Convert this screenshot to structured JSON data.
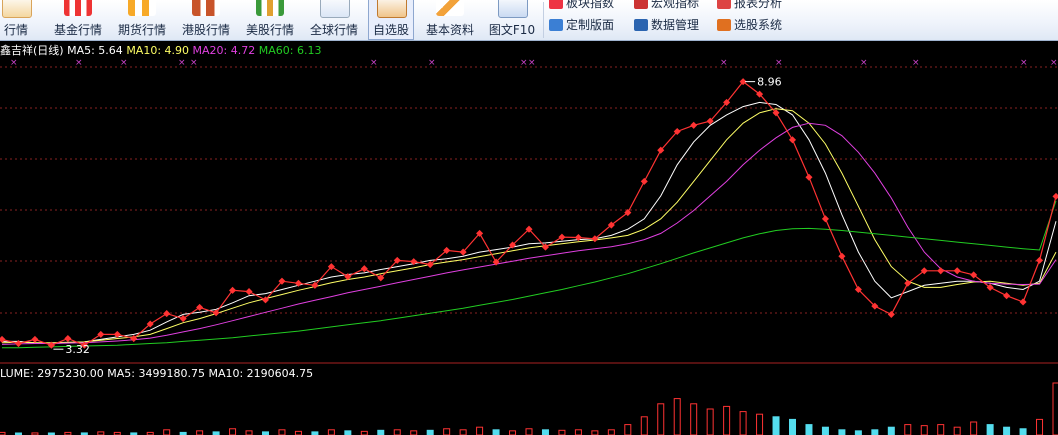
{
  "toolbar": {
    "items": [
      {
        "label": "行情",
        "icon": "chart-line-icon"
      },
      {
        "label": "基金行情",
        "icon": "bar-chart-icon"
      },
      {
        "label": "期货行情",
        "icon": "bar-chart-icon"
      },
      {
        "label": "港股行情",
        "icon": "bar-chart-icon"
      },
      {
        "label": "美股行情",
        "icon": "bar-chart-icon"
      },
      {
        "label": "全球行情",
        "icon": "line-chart-icon"
      },
      {
        "label": "自选股",
        "icon": "watchlist-icon"
      },
      {
        "label": "基本资料",
        "icon": "pencil-icon"
      },
      {
        "label": "图文F10",
        "icon": "document-icon"
      }
    ],
    "links": [
      {
        "label": "板块指数",
        "icon": "sector-index-icon"
      },
      {
        "label": "宏观指标",
        "icon": "macro-indicator-icon"
      },
      {
        "label": "报表分析",
        "icon": "report-icon"
      },
      {
        "label": "定制版面",
        "icon": "custom-layout-icon"
      },
      {
        "label": "数据管理",
        "icon": "data-manage-icon"
      },
      {
        "label": "选股系统",
        "icon": "stock-screener-icon"
      }
    ]
  },
  "legend": {
    "title": "鑫吉祥(日线)",
    "ma5": "MA5: 5.64",
    "ma10": "MA10: 4.90",
    "ma20": "MA20: 4.72",
    "ma60": "MA60: 6.13"
  },
  "volume_legend": {
    "text": "LUME: 2975230.00  MA5: 3499180.75  MA10: 2190604.75"
  },
  "annotations": {
    "high": "8.96",
    "low": "3.32"
  },
  "colors": {
    "price": "#ff3333",
    "ma5": "#ffffff",
    "ma10": "#ffff66",
    "ma20": "#e040e0",
    "ma60": "#22cc22",
    "grid": "#882222",
    "vol_up": "#ff3333",
    "vol_down": "#55ddee"
  },
  "chart_data": {
    "type": "line",
    "title": "鑫吉祥(日线)",
    "high_label": 8.96,
    "low_label": 3.32,
    "series": [
      {
        "name": "MA5",
        "values": [
          2.75,
          2.75,
          2.72,
          2.7,
          2.72,
          2.74,
          2.8,
          2.86,
          2.92,
          3.02,
          3.22,
          3.4,
          3.45,
          3.52,
          3.68,
          3.85,
          3.9,
          4.0,
          4.1,
          4.2,
          4.3,
          4.36,
          4.4,
          4.48,
          4.55,
          4.62,
          4.7,
          4.74,
          4.8,
          4.9,
          4.96,
          5.02,
          5.1,
          5.12,
          5.16,
          5.2,
          5.22,
          5.3,
          5.45,
          5.7,
          6.25,
          7.0,
          7.55,
          7.95,
          8.2,
          8.4,
          8.5,
          8.45,
          8.2,
          7.6,
          6.8,
          5.8,
          4.9,
          4.2,
          3.8,
          3.95,
          4.1,
          4.15,
          4.2,
          4.2,
          4.15,
          4.05,
          4.0,
          4.2,
          5.64
        ]
      },
      {
        "name": "MA10",
        "values": [
          2.72,
          2.73,
          2.72,
          2.72,
          2.73,
          2.74,
          2.78,
          2.82,
          2.86,
          2.92,
          3.06,
          3.2,
          3.3,
          3.42,
          3.55,
          3.68,
          3.78,
          3.88,
          3.98,
          4.07,
          4.16,
          4.24,
          4.3,
          4.38,
          4.45,
          4.52,
          4.6,
          4.66,
          4.72,
          4.79,
          4.86,
          4.93,
          5.0,
          5.05,
          5.1,
          5.15,
          5.19,
          5.24,
          5.3,
          5.45,
          5.7,
          6.1,
          6.6,
          7.1,
          7.6,
          8.0,
          8.25,
          8.35,
          8.3,
          8.0,
          7.5,
          6.8,
          6.0,
          5.2,
          4.55,
          4.2,
          4.05,
          4.05,
          4.12,
          4.18,
          4.2,
          4.15,
          4.1,
          4.15,
          4.9
        ]
      },
      {
        "name": "MA20",
        "values": [
          2.68,
          2.69,
          2.7,
          2.7,
          2.71,
          2.72,
          2.74,
          2.76,
          2.79,
          2.83,
          2.9,
          2.98,
          3.06,
          3.15,
          3.25,
          3.35,
          3.45,
          3.55,
          3.65,
          3.74,
          3.83,
          3.92,
          4.0,
          4.08,
          4.16,
          4.24,
          4.32,
          4.4,
          4.47,
          4.54,
          4.61,
          4.68,
          4.75,
          4.81,
          4.87,
          4.93,
          4.98,
          5.03,
          5.1,
          5.2,
          5.35,
          5.6,
          5.9,
          6.25,
          6.6,
          7.0,
          7.35,
          7.65,
          7.9,
          8.0,
          7.95,
          7.7,
          7.3,
          6.8,
          6.2,
          5.5,
          4.9,
          4.5,
          4.3,
          4.2,
          4.15,
          4.13,
          4.12,
          4.13,
          4.72
        ]
      },
      {
        "name": "MA60",
        "values": [
          2.6,
          2.6,
          2.61,
          2.62,
          2.63,
          2.64,
          2.65,
          2.66,
          2.68,
          2.7,
          2.72,
          2.75,
          2.78,
          2.81,
          2.84,
          2.88,
          2.92,
          2.96,
          3.0,
          3.05,
          3.1,
          3.15,
          3.2,
          3.25,
          3.31,
          3.37,
          3.43,
          3.49,
          3.55,
          3.62,
          3.69,
          3.76,
          3.84,
          3.92,
          4.0,
          4.09,
          4.18,
          4.28,
          4.38,
          4.5,
          4.62,
          4.75,
          4.88,
          5.0,
          5.12,
          5.24,
          5.34,
          5.42,
          5.46,
          5.47,
          5.45,
          5.42,
          5.38,
          5.34,
          5.3,
          5.26,
          5.22,
          5.18,
          5.14,
          5.1,
          5.06,
          5.02,
          4.98,
          4.95,
          6.13
        ]
      }
    ],
    "ylim": [
      2.4,
      9.4
    ]
  }
}
